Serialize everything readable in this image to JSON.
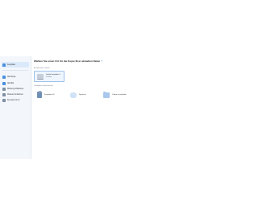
{
  "sidebar": {
    "items": [
      {
        "label": "Festplatte",
        "icon": "disk-icon",
        "active": true
      },
      {
        "label": "Alle Dinge",
        "icon": "copy-icon",
        "active": false
      },
      {
        "label": "Aktivität",
        "icon": "activity-icon",
        "active": false
      },
      {
        "label": "Wartung & Backups",
        "icon": "maintenance-icon",
        "active": false
      },
      {
        "label": "Weitere Funktionen",
        "icon": "tools-icon",
        "active": false
      },
      {
        "label": "Kennwort & Co.",
        "icon": "key-icon",
        "active": false
      }
    ]
  },
  "main": {
    "title": "Wählen Sie einen Ort für die Kopie Ihrer aktuellen Daten",
    "help": "?",
    "source_label": "Ausgewählte Quelle",
    "source_card": {
      "name": "Lokale Festplatte C:",
      "sub": "Partition"
    },
    "dest_label": "Verfügbare Speicherorte",
    "destinations": [
      {
        "label": "Festplatte 01",
        "icon": "usb-drive-icon"
      },
      {
        "label": "Speicher",
        "icon": "cloud-icon"
      },
      {
        "label": "Ordner auswählen",
        "icon": "folder-icon"
      }
    ]
  },
  "colors": {
    "accent": "#3b7fd4",
    "sidebar_bg": "#f3f7fc",
    "card_border": "#9ec2ea"
  }
}
